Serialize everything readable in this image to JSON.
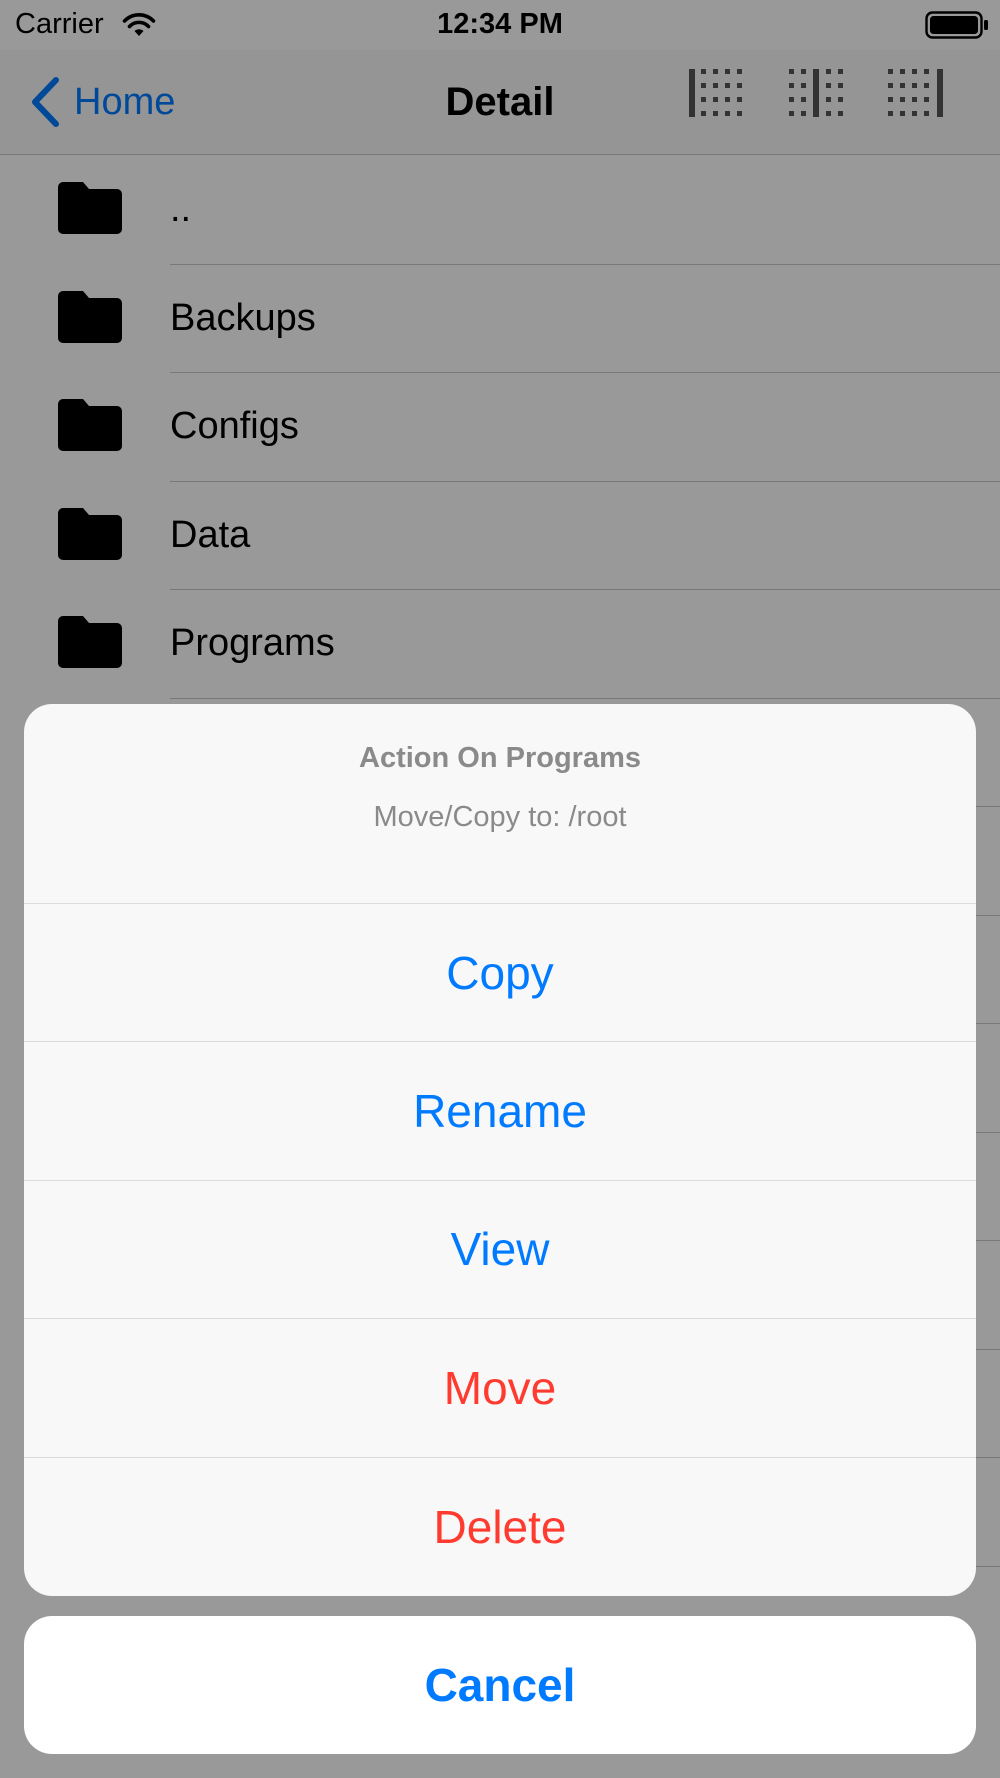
{
  "status_bar": {
    "carrier": "Carrier",
    "time": "12:34 PM",
    "wifi_icon": "wifi-icon",
    "battery_icon": "battery-icon"
  },
  "nav": {
    "back_label": "Home",
    "title": "Detail",
    "view_mode_icons": [
      "grid-left-icon",
      "grid-center-icon",
      "grid-right-icon"
    ]
  },
  "files": [
    {
      "name": "..",
      "icon": "folder-icon"
    },
    {
      "name": "Backups",
      "icon": "folder-icon"
    },
    {
      "name": "Configs",
      "icon": "folder-icon"
    },
    {
      "name": "Data",
      "icon": "folder-icon"
    },
    {
      "name": "Programs",
      "icon": "folder-icon"
    }
  ],
  "action_sheet": {
    "title": "Action On Programs",
    "message": "Move/Copy to: /root",
    "actions": [
      {
        "label": "Copy",
        "style": "default"
      },
      {
        "label": "Rename",
        "style": "default"
      },
      {
        "label": "View",
        "style": "default"
      },
      {
        "label": "Move",
        "style": "destructive"
      },
      {
        "label": "Delete",
        "style": "destructive"
      }
    ],
    "cancel_label": "Cancel"
  },
  "colors": {
    "accent": "#007aff",
    "destructive": "#ff3b30",
    "dim": "rgba(0,0,0,0.4)"
  }
}
